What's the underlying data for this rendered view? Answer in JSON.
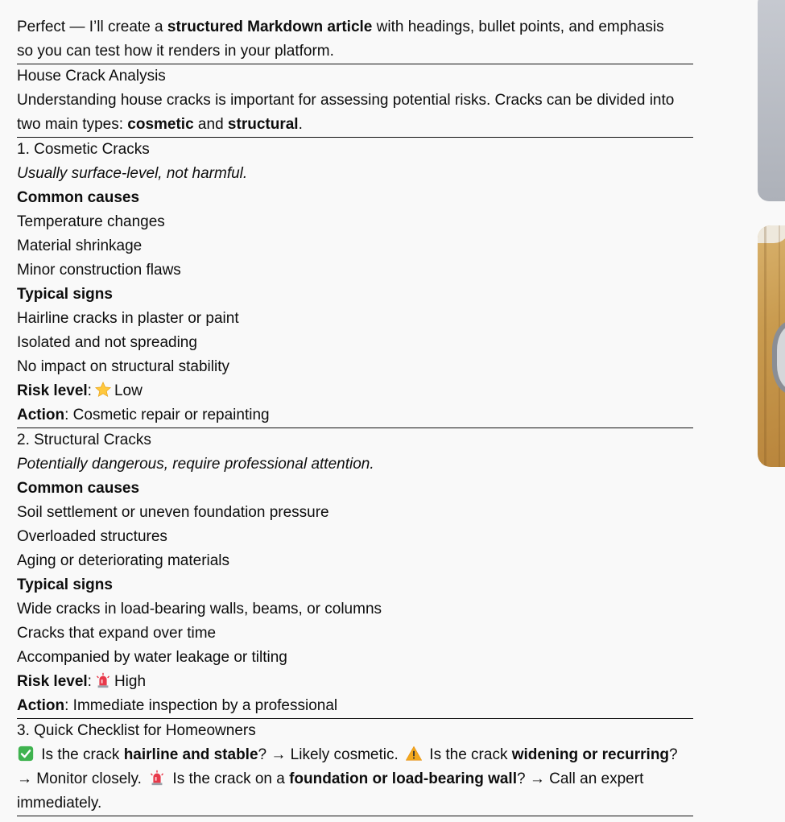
{
  "intro": {
    "t1": "Perfect — I’ll create a ",
    "b1": "structured Markdown article",
    "t2": " with headings, bullet points, and emphasis",
    "line2": "so you can test how it renders in your platform."
  },
  "title": "House Crack Analysis",
  "summary": {
    "t1": "Understanding house cracks is important for assessing potential risks. Cracks can be divided into",
    "t2": "two main types: ",
    "b1": "cosmetic",
    "t3": " and ",
    "b2": "structural",
    "t4": "."
  },
  "cosmetic": {
    "heading": "1. Cosmetic Cracks",
    "subtitle": "Usually surface-level, not harmful.",
    "causes_label": "Common causes",
    "causes": [
      "Temperature changes",
      "Material shrinkage",
      "Minor construction flaws"
    ],
    "signs_label": "Typical signs",
    "signs": [
      "Hairline cracks in plaster or paint",
      "Isolated and not spreading",
      "No impact on structural stability"
    ],
    "risk_label": "Risk level",
    "risk_icon": "star-icon",
    "risk_value": "Low",
    "action_label": "Action",
    "action_value": ": Cosmetic repair or repainting"
  },
  "structural": {
    "heading": "2. Structural Cracks",
    "subtitle": "Potentially dangerous, require professional attention.",
    "causes_label": "Common causes",
    "causes": [
      "Soil settlement or uneven foundation pressure",
      "Overloaded structures",
      "Aging or deteriorating materials"
    ],
    "signs_label": "Typical signs",
    "signs": [
      "Wide cracks in load-bearing walls, beams, or columns",
      "Cracks that expand over time",
      "Accompanied by water leakage or tilting"
    ],
    "risk_label": "Risk level",
    "risk_icon": "siren-icon",
    "risk_value": "High",
    "action_label": "Action",
    "action_value": ": Immediate inspection by a professional"
  },
  "checklist": {
    "heading": "3. Quick Checklist for Homeowners",
    "a1": " Is the crack ",
    "ab": "hairline and stable",
    "a2": "? → Likely cosmetic. ",
    "b1": " Is the crack ",
    "bb": "widening or recurring",
    "b2": "? → Monitor closely. ",
    "c1": " Is the crack on a ",
    "cb": "foundation or load-bearing wall",
    "c2": "? → Call an expert immediately."
  },
  "icons": {
    "check": "check-icon",
    "warning": "warning-icon",
    "siren": "siren-icon"
  },
  "colors": {
    "check": "#3fb34f",
    "warning": "#f2a81d",
    "siren": "#e8394a",
    "star": "#ffc83d"
  }
}
